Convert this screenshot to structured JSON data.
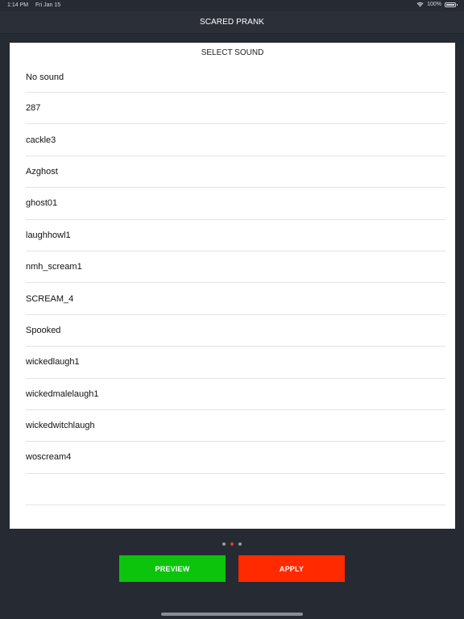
{
  "status_bar": {
    "time": "1:14 PM",
    "date": "Fri Jan 15",
    "battery": "100%",
    "icons": [
      "wifi-icon",
      "battery-icon"
    ]
  },
  "header": {
    "title": "SCARED PRANK"
  },
  "panel": {
    "title": "SELECT SOUND",
    "sounds": [
      "No sound",
      "287",
      "cackle3",
      "Azghost",
      "ghost01",
      "laughhowl1",
      "nmh_scream1",
      "SCREAM_4",
      "Spooked",
      "wickedlaugh1",
      "wickedmalelaugh1",
      "wickedwitchlaugh",
      "woscream4",
      ""
    ]
  },
  "pager": {
    "pages": 3,
    "current": 2,
    "active_color": "#e53925"
  },
  "actions": {
    "preview_label": "PREVIEW",
    "apply_label": "APPLY",
    "preview_color": "#0bc40b",
    "apply_color": "#ff2a00"
  }
}
